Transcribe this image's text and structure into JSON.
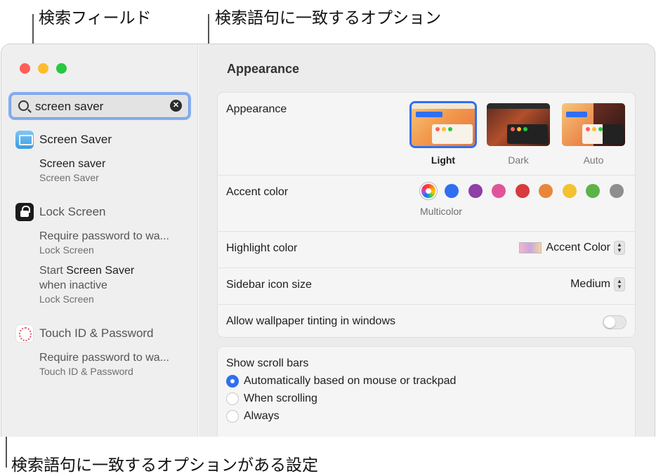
{
  "callouts": {
    "search_field": "検索フィールド",
    "matching_options": "検索語句に一致するオプション",
    "matching_settings": "検索語句に一致するオプションがある設定"
  },
  "sidebar": {
    "search": {
      "value": "screen saver",
      "clear_icon": "x-circle-icon"
    },
    "groups": [
      {
        "title": "Screen Saver",
        "icon": "screen-saver-icon",
        "items": [
          {
            "line1": "Screen saver",
            "line2": "Screen Saver"
          }
        ]
      },
      {
        "title": "Lock Screen",
        "icon": "lock-icon",
        "items": [
          {
            "line1": "Require password to wa...",
            "line2": "Lock Screen"
          },
          {
            "line1a": "Start ",
            "line1b": "Screen Saver",
            "line1c": "when inactive",
            "line2": "Lock Screen"
          }
        ]
      },
      {
        "title": "Touch ID & Password",
        "icon": "fingerprint-icon",
        "items": [
          {
            "line1": "Require password to wa...",
            "line2": "Touch ID & Password"
          }
        ]
      }
    ]
  },
  "content": {
    "title": "Appearance",
    "appearance": {
      "label": "Appearance",
      "options": [
        {
          "name": "Light",
          "selected": true
        },
        {
          "name": "Dark",
          "selected": false
        },
        {
          "name": "Auto",
          "selected": false
        }
      ]
    },
    "accent": {
      "label": "Accent color",
      "selected_label": "Multicolor",
      "colors": [
        "#2f6ff0",
        "#8e3fa8",
        "#e0559a",
        "#d83a3e",
        "#e8873a",
        "#f2c230",
        "#5db348",
        "#8e8e8e"
      ]
    },
    "highlight": {
      "label": "Highlight color",
      "value": "Accent Color"
    },
    "sidebar_icon": {
      "label": "Sidebar icon size",
      "value": "Medium"
    },
    "tinting": {
      "label": "Allow wallpaper tinting in windows",
      "on": false
    },
    "scroll_bars": {
      "label": "Show scroll bars",
      "options": [
        {
          "label": "Automatically based on mouse or trackpad",
          "selected": true
        },
        {
          "label": "When scrolling",
          "selected": false
        },
        {
          "label": "Always",
          "selected": false
        }
      ]
    }
  }
}
